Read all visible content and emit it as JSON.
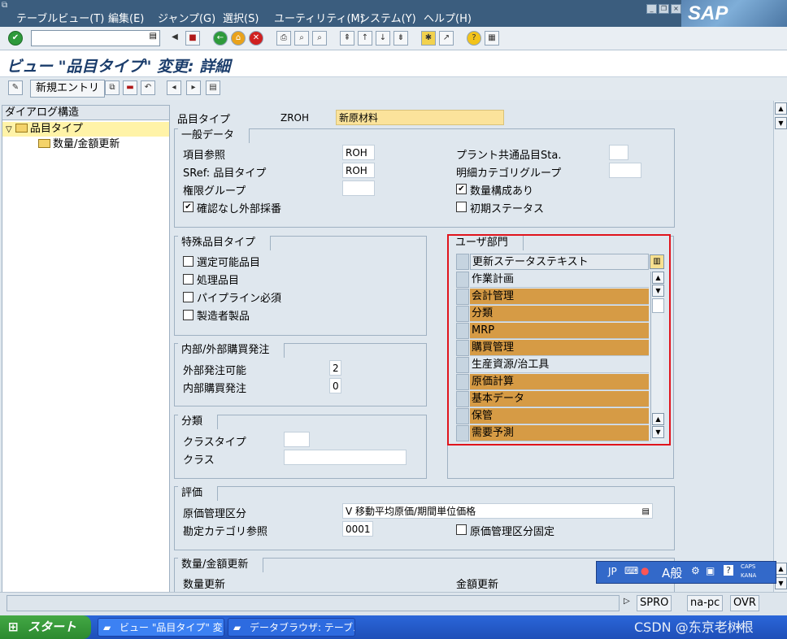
{
  "menu": {
    "items": [
      "テーブルビュー(T)",
      "編集(E)",
      "ジャンプ(G)",
      "選択(S)",
      "ユーティリティ(M)",
      "システム(Y)",
      "ヘルプ(H)"
    ],
    "logo": "SAP"
  },
  "toolbar": {
    "command_value": ""
  },
  "title": "ビュー \"品目タイプ\" 変更: 詳細",
  "apptoolbar": {
    "new_entries_label": "新規エントリ"
  },
  "tree": {
    "header": "ダイアログ構造",
    "items": [
      {
        "label": "品目タイプ",
        "selected": true
      },
      {
        "label": "数量/金額更新",
        "selected": false
      }
    ]
  },
  "header_fields": {
    "material_type_label": "品目タイプ",
    "material_type_value": "ZROH",
    "material_type_desc": "新原材料"
  },
  "general": {
    "title": "一般データ",
    "ref_material_label": "項目参照",
    "ref_material_value": "ROH",
    "sref_label": "SRef: 品目タイプ",
    "sref_value": "ROH",
    "auth_group_label": "権限グループ",
    "auth_group_value": "",
    "ext_number_label": "確認なし外部採番",
    "ext_number_checked": true,
    "plant_status_label": "プラント共通品目Sta.",
    "plant_status_value": "",
    "item_cat_group_label": "明細カテゴリグループ",
    "item_cat_group_value": "",
    "qty_struct_label": "数量構成あり",
    "qty_struct_checked": true,
    "init_status_label": "初期ステータス",
    "init_status_checked": false
  },
  "special": {
    "title": "特殊品目タイプ",
    "options": [
      {
        "label": "選定可能品目",
        "checked": false
      },
      {
        "label": "処理品目",
        "checked": false
      },
      {
        "label": "パイプライン必須",
        "checked": false
      },
      {
        "label": "製造者製品",
        "checked": false
      }
    ]
  },
  "internal_external": {
    "title": "内部/外部購買発注",
    "ext_po_label": "外部発注可能",
    "ext_po_value": "2",
    "int_po_label": "内部購買発注",
    "int_po_value": "0"
  },
  "classification": {
    "title": "分類",
    "class_type_label": "クラスタイプ",
    "class_type_value": "",
    "class_label": "クラス",
    "class_value": ""
  },
  "user_dept": {
    "title": "ユーザ部門",
    "column_header": "更新ステータステキスト",
    "rows": [
      {
        "label": "作業計画",
        "highlighted": false
      },
      {
        "label": "会計管理",
        "highlighted": true
      },
      {
        "label": "分類",
        "highlighted": true
      },
      {
        "label": "MRP",
        "highlighted": true
      },
      {
        "label": "購買管理",
        "highlighted": true
      },
      {
        "label": "生産資源/治工具",
        "highlighted": false
      },
      {
        "label": "原価計算",
        "highlighted": true
      },
      {
        "label": "基本データ",
        "highlighted": true
      },
      {
        "label": "保管",
        "highlighted": true
      },
      {
        "label": "需要予測",
        "highlighted": true
      }
    ],
    "highlight_color": "#d69b45"
  },
  "valuation": {
    "title": "評価",
    "price_control_label": "原価管理区分",
    "price_control_value": "V 移動平均原価/期間単位価格",
    "account_cat_label": "勘定カテゴリ参照",
    "account_cat_value": "0001",
    "price_fixed_label": "原価管理区分固定",
    "price_fixed_checked": false
  },
  "qty_value": {
    "title": "数量/金額更新",
    "qty_update_label": "数量更新",
    "value_update_label": "金額更新"
  },
  "statusbar": {
    "system": "SPRO",
    "host": "na-pc",
    "mode": "OVR"
  },
  "ime": {
    "lang": "JP",
    "mode": "A般",
    "caps": "CAPS",
    "kana": "KANA"
  },
  "taskbar": {
    "start": "スタート",
    "tasks": [
      "ビュー \"品目タイプ\" 変...",
      "データブラウザ: テーブル..."
    ]
  },
  "watermark": "CSDN @东京老树根"
}
